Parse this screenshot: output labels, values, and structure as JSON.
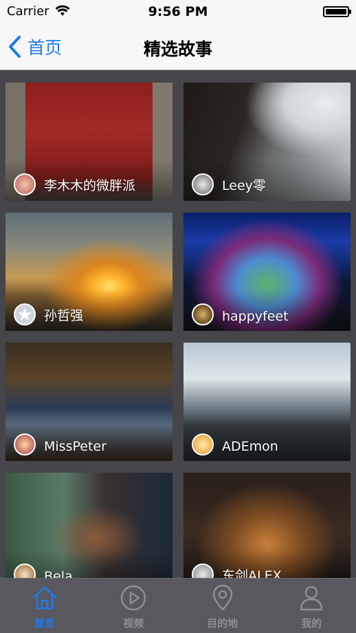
{
  "status_bar": {
    "carrier": "Carrier",
    "time": "9:56 PM"
  },
  "nav": {
    "back_label": "首页",
    "title": "精选故事"
  },
  "stories": [
    {
      "author": "李木木的微胖派"
    },
    {
      "author": "Leey零"
    },
    {
      "author": "孙哲强"
    },
    {
      "author": "happyfeet"
    },
    {
      "author": "MissPeter"
    },
    {
      "author": "ADEmon"
    },
    {
      "author": "Bela"
    },
    {
      "author": "东剑ALEX"
    }
  ],
  "tabs": [
    {
      "label": "首页",
      "icon": "home-icon",
      "active": true
    },
    {
      "label": "视频",
      "icon": "play-icon",
      "active": false
    },
    {
      "label": "目的地",
      "icon": "location-pin-icon",
      "active": false
    },
    {
      "label": "我的",
      "icon": "user-icon",
      "active": false
    }
  ],
  "colors": {
    "accent": "#1a7bf0",
    "grid_bg": "#45454a",
    "tab_bar_bg": "#5a5a5f"
  }
}
